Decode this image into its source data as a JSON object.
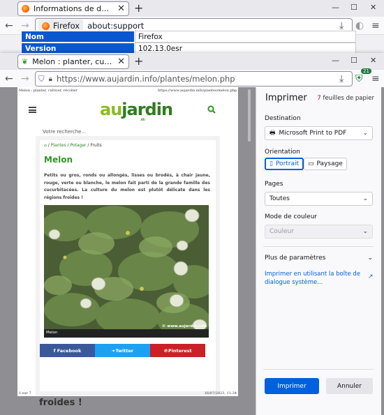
{
  "back_window": {
    "tab_title": "Informations de dépannage",
    "url_identity": "Firefox",
    "url": "about:support",
    "table_rows": [
      {
        "key": "Nom",
        "value": "Firefox"
      },
      {
        "key": "Version",
        "value": "102.13.0esr"
      }
    ]
  },
  "front_window": {
    "tab_title": "Melon : planter, cultiver, récolter",
    "url": "https://www.aujardin.info/plantes/melon.php",
    "ext_badge": "21"
  },
  "preview": {
    "hdr_left": "Melon : planter, cultiver, récolter",
    "hdr_right": "https://www.aujardin.info/plantes/melon.php",
    "logo_a": "au",
    "logo_b": "jardin",
    "logo_sub": ".info",
    "search_placeholder": "Votre recherche...",
    "crumb_home": "⌂",
    "crumb_1": "Plantes",
    "crumb_2": "Potager",
    "crumb_3": "Fruits",
    "title": "Melon",
    "description": "Petits ou gros, ronds ou allongés, lisses ou brodés, à chair jaune, rouge, verte ou blanche, le melon fait parti de la grande famille des cucurbitacées. La culture du melon est plutôt délicate dans les régions froides !",
    "caption": "Melon",
    "copyright": "© www.aujardin.info",
    "share": [
      "f Facebook",
      "Twitter",
      "Pinterest"
    ],
    "footer_left": "1 sur 7",
    "footer_right": "16/07/2023, 11:34"
  },
  "background_text": "froides !",
  "print": {
    "title": "Imprimer",
    "sheet_count": "7",
    "sheet_label": "feuilles de papier",
    "destination_label": "Destination",
    "destination_value": "Microsoft Print to PDF",
    "orientation_label": "Orientation",
    "portrait": "Portrait",
    "landscape": "Paysage",
    "pages_label": "Pages",
    "pages_value": "Toutes",
    "color_label": "Mode de couleur",
    "color_value": "Couleur",
    "more_settings": "Plus de paramètres",
    "system_dialog": "Imprimer en utilisant la boîte de dialogue système...",
    "print_button": "Imprimer",
    "cancel_button": "Annuler"
  },
  "colors": {
    "accent": "#0060df",
    "table_header": "#0b57d0",
    "garden_green": "#2e9a1f",
    "facebook": "#3b5998",
    "twitter": "#1da1f2",
    "pinterest": "#cb2027"
  }
}
